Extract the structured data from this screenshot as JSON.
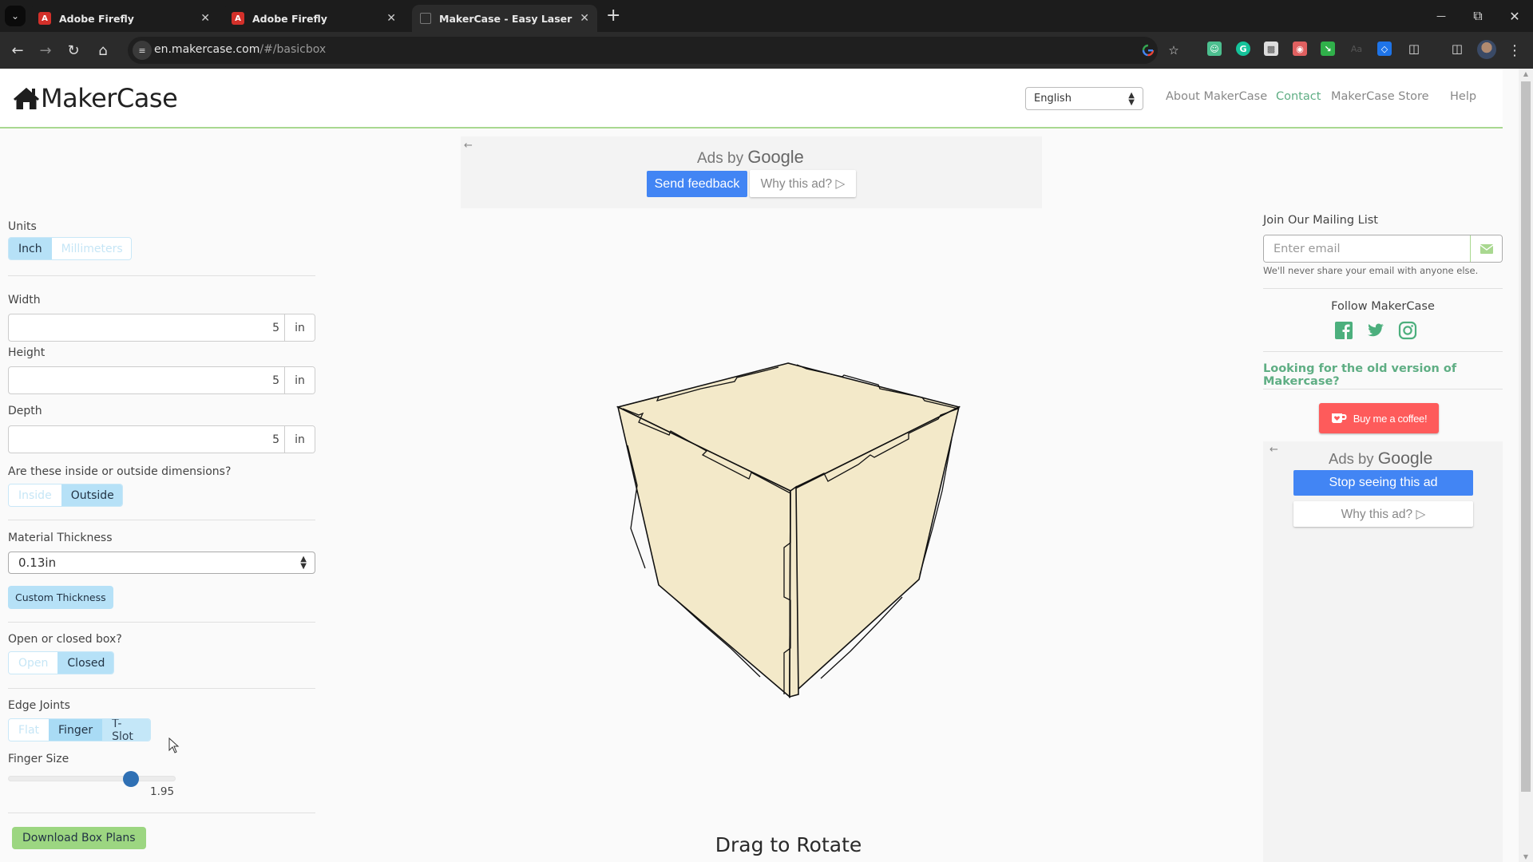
{
  "browser": {
    "tabs": [
      {
        "title": "Adobe Firefly",
        "favicon": "adobe-icon",
        "active": false
      },
      {
        "title": "Adobe Firefly",
        "favicon": "adobe-icon",
        "active": false
      },
      {
        "title": "MakerCase - Easy Laser Cut Ca",
        "favicon": "cube-icon",
        "active": true
      }
    ],
    "url_host": "en.makercase.com",
    "url_path": "/#/basicbox",
    "icons": {
      "back": "←",
      "forward": "→",
      "reload": "↻",
      "home": "⌂",
      "close": "✕",
      "newtab": "+",
      "minimize": "—",
      "restore": "⧉",
      "menu": "⋮",
      "star": "☆",
      "tabsearch": "⌄"
    }
  },
  "header": {
    "logo_text": "MakerCase",
    "language": "English",
    "nav": [
      {
        "label": "About MakerCase"
      },
      {
        "label": "Contact"
      },
      {
        "label": "MakerCase Store"
      },
      {
        "label": "Help"
      }
    ]
  },
  "top_ad": {
    "back_arrow": "←",
    "ads_by": "Ads by",
    "google": "Google",
    "send_feedback": "Send feedback",
    "why_this_ad": "Why this ad? ▷"
  },
  "settings": {
    "units": {
      "label": "Units",
      "options": [
        "Inch",
        "Millimeters"
      ],
      "selected": "Inch"
    },
    "width": {
      "label": "Width",
      "value": "5",
      "unit": "in"
    },
    "height": {
      "label": "Height",
      "value": "5",
      "unit": "in"
    },
    "depth": {
      "label": "Depth",
      "value": "5",
      "unit": "in"
    },
    "dimensions": {
      "label": "Are these inside or outside dimensions?",
      "options": [
        "Inside",
        "Outside"
      ],
      "selected": "Outside"
    },
    "material_thickness": {
      "label": "Material Thickness",
      "value": "0.13in",
      "custom_button": "Custom Thickness"
    },
    "open_closed": {
      "label": "Open or closed box?",
      "options": [
        "Open",
        "Closed"
      ],
      "selected": "Closed"
    },
    "edge_joints": {
      "label": "Edge Joints",
      "options": [
        "Flat",
        "Finger",
        "T-Slot"
      ],
      "selected": "Finger"
    },
    "finger_size": {
      "label": "Finger Size",
      "value": "1.95",
      "slider_fraction": 0.76
    },
    "download_button": "Download Box Plans"
  },
  "viewer": {
    "drag_text": "Drag to Rotate",
    "box_fill": "#f3e9c9",
    "box_stroke": "#111111"
  },
  "sidebar": {
    "mailing_title": "Join Our Mailing List",
    "email_placeholder": "Enter email",
    "email_note": "We'll never share your email with anyone else.",
    "follow_title": "Follow MakerCase",
    "social": [
      "facebook-icon",
      "twitter-icon",
      "instagram-icon"
    ],
    "old_version_link": "Looking for the old version of Makercase?",
    "coffee_button": "Buy me a coffee!",
    "ad": {
      "back_arrow": "←",
      "ads_by": "Ads by",
      "google": "Google",
      "stop_seeing": "Stop seeing this ad",
      "why_this_ad": "Why this ad? ▷"
    }
  },
  "colors": {
    "accent_green": "#5fae84",
    "selected_blue": "#b6e1f7",
    "download_green": "#9cd681",
    "google_blue": "#4285f4",
    "coffee_red": "#fe5b5b",
    "slider_thumb": "#2f70b4"
  }
}
